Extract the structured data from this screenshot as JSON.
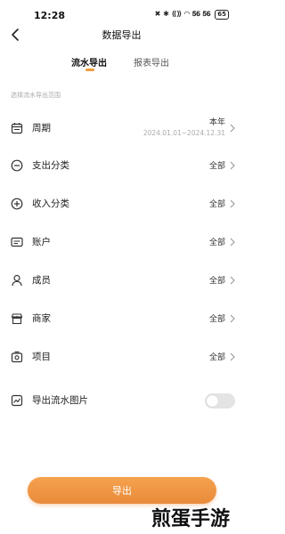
{
  "status_bar": {
    "time": "12:28",
    "icons": "✖ ✱ ⟪⟫ ◠ 𝟓𝟔 𝟓𝟔",
    "battery": "65"
  },
  "nav": {
    "title": "数据导出"
  },
  "tabs": [
    {
      "label": "流水导出",
      "active": true
    },
    {
      "label": "报表导出",
      "active": false
    }
  ],
  "hint": "选择流水导出范围",
  "rows": [
    {
      "label": "周期",
      "value": "本年",
      "sub": "2024.01.01~2024.12.31",
      "icon": "calendar-icon"
    },
    {
      "label": "支出分类",
      "value": "全部",
      "icon": "minus-circle-icon"
    },
    {
      "label": "收入分类",
      "value": "全部",
      "icon": "plus-circle-icon"
    },
    {
      "label": "账户",
      "value": "全部",
      "icon": "card-icon"
    },
    {
      "label": "成员",
      "value": "全部",
      "icon": "person-icon"
    },
    {
      "label": "商家",
      "value": "全部",
      "icon": "store-icon"
    },
    {
      "label": "项目",
      "value": "全部",
      "icon": "project-icon"
    }
  ],
  "image_export": {
    "label": "导出流水图片",
    "enabled": false,
    "icon": "image-chart-icon"
  },
  "export_button": {
    "label": "导出"
  },
  "watermark": "煎蛋手游",
  "colors": {
    "accent": "#f39c3c",
    "button": "#ef9444",
    "toggle_off": "#e4e4e4"
  }
}
